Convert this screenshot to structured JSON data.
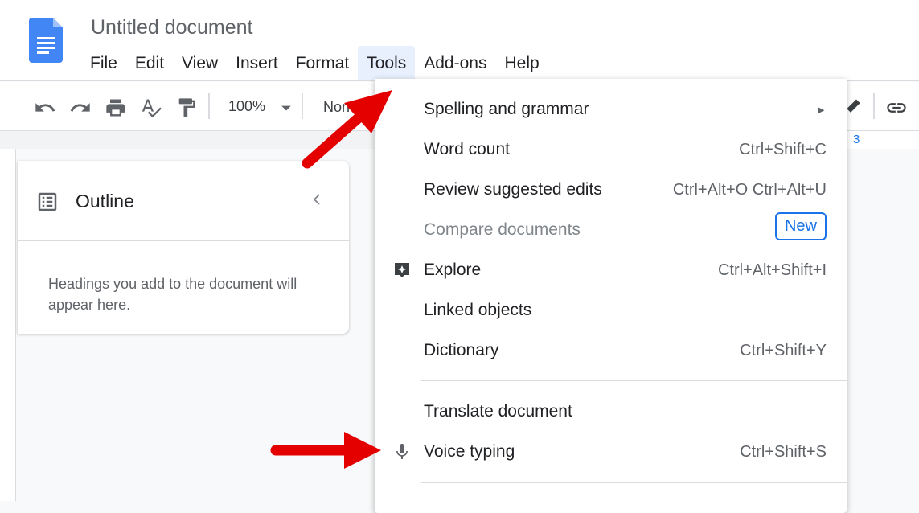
{
  "document": {
    "title": "Untitled document"
  },
  "menubar": [
    "File",
    "Edit",
    "View",
    "Insert",
    "Format",
    "Tools",
    "Add-ons",
    "Help"
  ],
  "toolbar": {
    "zoom": "100%",
    "style": "Norm"
  },
  "ruler": {
    "mark": "3"
  },
  "outline": {
    "title": "Outline",
    "hint": "Headings you add to the document will appear here."
  },
  "tools_menu": {
    "items": [
      {
        "label": "Spelling and grammar",
        "shortcut": "►"
      },
      {
        "label": "Word count",
        "shortcut": "Ctrl+Shift+C"
      },
      {
        "label": "Review suggested edits",
        "shortcut": "Ctrl+Alt+O Ctrl+Alt+U"
      },
      {
        "label": "Compare documents",
        "badge": "New",
        "disabled": true
      },
      {
        "label": "Explore",
        "shortcut": "Ctrl+Alt+Shift+I",
        "icon": "explore-icon"
      },
      {
        "label": "Linked objects",
        "shortcut": ""
      },
      {
        "label": "Dictionary",
        "shortcut": "Ctrl+Shift+Y"
      },
      {
        "label": "Translate document",
        "shortcut": ""
      },
      {
        "label": "Voice typing",
        "shortcut": "Ctrl+Shift+S",
        "icon": "microphone-icon"
      }
    ]
  },
  "colors": {
    "accent": "#1a73e8",
    "annotation_arrow": "#e50000",
    "menu_highlight": "#e8f0fe"
  }
}
